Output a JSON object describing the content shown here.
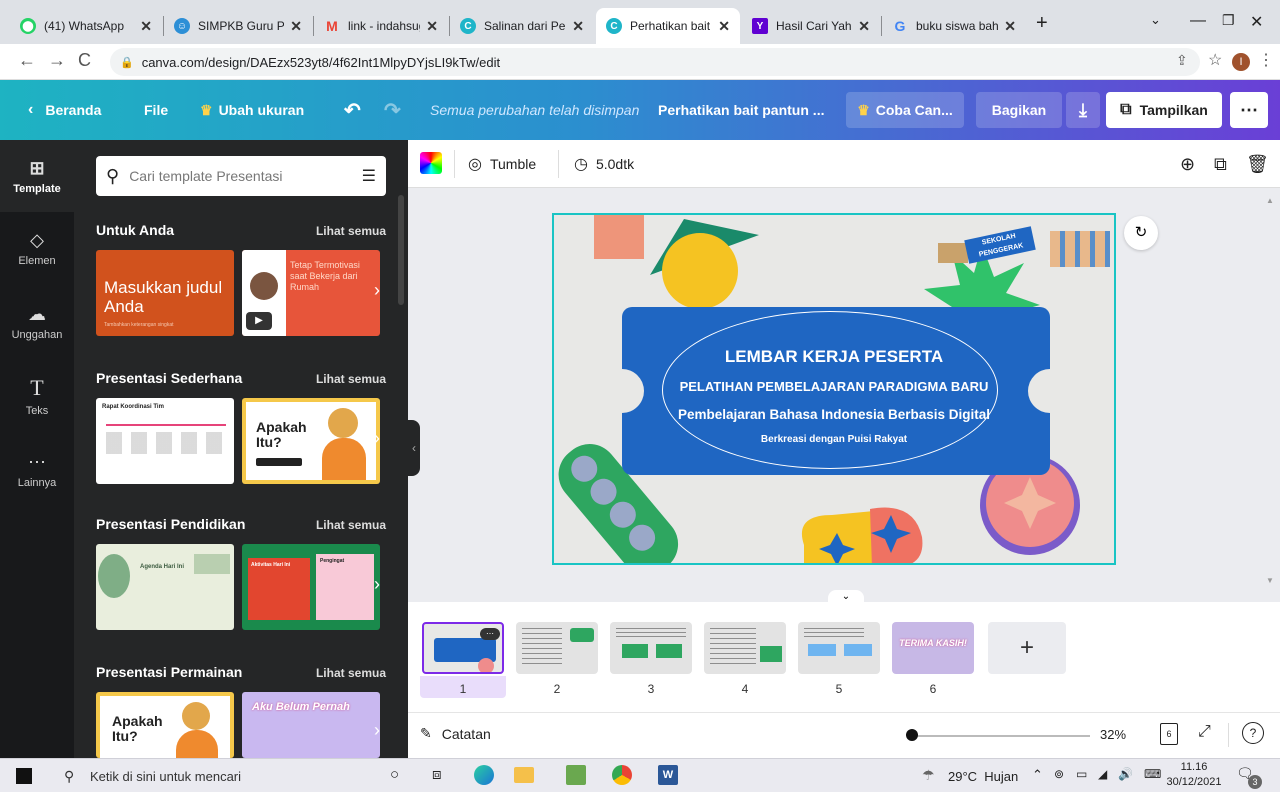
{
  "browser": {
    "tabs": [
      {
        "title": "(41) WhatsApp",
        "icon": "whatsapp-icon",
        "color": "#25d366",
        "glyph": "41"
      },
      {
        "title": "SIMPKB Guru Per",
        "icon": "simpkb-icon",
        "color": "#2d8fd6",
        "glyph": "S"
      },
      {
        "title": "link - indahsugiy",
        "icon": "gmail-icon",
        "color": "#ea4335",
        "glyph": "M"
      },
      {
        "title": "Salinan dari Perh",
        "icon": "canva-icon",
        "color": "#1fb5c9",
        "glyph": "C"
      },
      {
        "title": "Perhatikan bait p",
        "icon": "canva-icon",
        "color": "#1fb5c9",
        "glyph": "C"
      },
      {
        "title": "Hasil Cari Yahoo",
        "icon": "yahoo-icon",
        "color": "#6001d2",
        "glyph": "Y"
      },
      {
        "title": "buku siswa bahas",
        "icon": "google-icon",
        "color": "#4285f4",
        "glyph": "G"
      }
    ],
    "url": "canva.com/design/DAEzx523yt8/4f62Int1MlpyDYjsLI9kTw/edit"
  },
  "toolbar": {
    "home": "Beranda",
    "file": "File",
    "resize": "Ubah ukuran",
    "saved_status": "Semua perubahan telah disimpan",
    "doc_title": "Perhatikan bait pantun ...",
    "try_canva": "Coba Can...",
    "share": "Bagikan",
    "present": "Tampilkan"
  },
  "rail": [
    {
      "label": "Template",
      "icon": "template-icon",
      "glyph": "⊞"
    },
    {
      "label": "Elemen",
      "icon": "elements-icon",
      "glyph": "△"
    },
    {
      "label": "Unggahan",
      "icon": "upload-cloud-icon",
      "glyph": "☁"
    },
    {
      "label": "Teks",
      "icon": "text-icon",
      "glyph": "T"
    },
    {
      "label": "Lainnya",
      "icon": "more-icon",
      "glyph": "⋯"
    }
  ],
  "panel": {
    "search_placeholder": "Cari template Presentasi",
    "see_all": "Lihat semua",
    "sections": [
      {
        "title": "Untuk Anda",
        "t1": {
          "big": "Masukkan judul Anda",
          "small": "Tambahkan keterangan singkat"
        },
        "t2": {
          "big": "Tetap Termotivasi saat Bekerja dari Rumah"
        }
      },
      {
        "title": "Presentasi Sederhana",
        "t1": {
          "big": "Rapat Koordinasi Tim"
        },
        "t2": {
          "big": "Apakah Itu?"
        }
      },
      {
        "title": "Presentasi Pendidikan",
        "t1": {
          "big": "Agenda Hari Ini"
        },
        "t2": {
          "big": "Aktivitas Hari Ini",
          "small": "Pengingat"
        }
      },
      {
        "title": "Presentasi Permainan",
        "t1": {
          "big": "Apakah Itu?"
        },
        "t2": {
          "big": "Aku Belum Pernah"
        }
      }
    ]
  },
  "editor": {
    "animation": "Tumble",
    "duration": "5.0dtk",
    "slide": {
      "badge": "SEKOLAH PENGGERAK",
      "line1": "LEMBAR KERJA PESERTA",
      "line2": "PELATIHAN PEMBELAJARAN PARADIGMA BARU",
      "line3": "Pembelajaran Bahasa Indonesia Berbasis Digital",
      "line4": "Berkreasi dengan Puisi Rakyat"
    },
    "pages": [
      "1",
      "2",
      "3",
      "4",
      "5",
      "6"
    ],
    "page6_text": "TERIMA KASIH!",
    "notes": "Catatan",
    "zoom": "32%",
    "page_count": "6",
    "zoom_fraction": 0.32
  },
  "taskbar": {
    "search_placeholder": "Ketik di sini untuk mencari",
    "weather": "29°C  Hujan",
    "time": "11.16",
    "date": "30/12/2021",
    "notif_count": "3"
  },
  "colors": {
    "toolbar_start": "#1eb3c2",
    "toolbar_end": "#6a3fd6",
    "ticket_blue": "#1f66c2",
    "slide_border": "#19c4c4"
  }
}
